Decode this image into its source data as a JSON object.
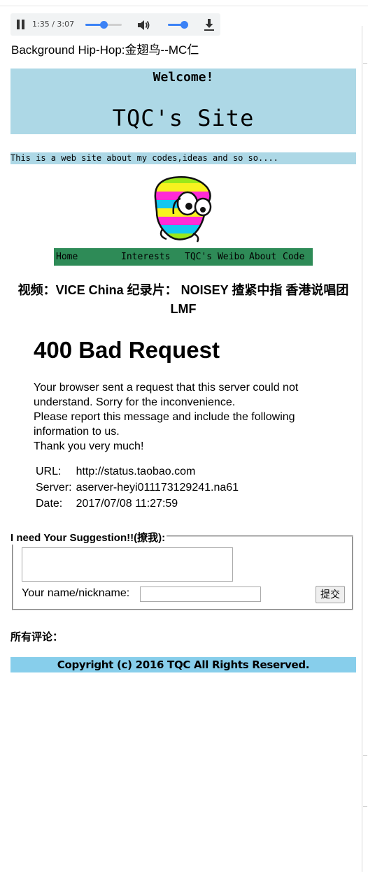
{
  "audio_player": {
    "time": "1:35 / 3:07",
    "progress_fraction": 0.51,
    "volume_fraction": 0.85,
    "accent_color": "#3b82f6",
    "icons": [
      "pause-icon",
      "volume-icon",
      "download-icon"
    ]
  },
  "background_music": "Background Hip-Hop:金翅鸟--MC仁",
  "header": {
    "welcome": "Welcome!",
    "site_title": "TQC's Site",
    "background_color": "#add8e6"
  },
  "about": "This is a web site about my codes,ideas and so so....",
  "nav": {
    "background_color": "#2e8b57",
    "items": [
      {
        "label": "Home"
      },
      {
        "label": "Interests"
      },
      {
        "label": "TQC's Weibo"
      },
      {
        "label": "About"
      },
      {
        "label": "Code"
      }
    ]
  },
  "video_title": "视频：VICE China 纪录片： NOISEY 揸紧中指 香港说唱团LMF",
  "error_frame": {
    "heading": "400 Bad Request",
    "message_lines": [
      "Your browser sent a request that this server could not understand. Sorry for the inconvenience.",
      "Please report this message and include the following information to us.",
      "Thank you very much!"
    ],
    "details": [
      {
        "key": "URL:",
        "value": "http://status.taobao.com"
      },
      {
        "key": "Server:",
        "value": "aserver-heyi011173129241.na61"
      },
      {
        "key": "Date:",
        "value": "2017/07/08 11:27:59"
      }
    ]
  },
  "suggestion_form": {
    "legend": "I need Your Suggestion!!(撩我):",
    "textarea_value": "",
    "name_label": "Your name/nickname:",
    "name_value": "",
    "submit_label": "提交"
  },
  "comments_label": "所有评论：",
  "footer": {
    "text": "Copyright (c) 2016 TQC All Rights Reserved.",
    "background_color": "#87ceeb"
  }
}
